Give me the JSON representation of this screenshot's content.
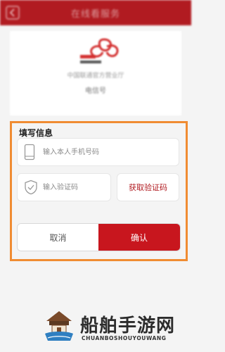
{
  "header": {
    "title": "在线看服务"
  },
  "top_card": {
    "line1": "中国联通官方营业厅",
    "line2": "电信号"
  },
  "form": {
    "section_title": "填写信息",
    "phone": {
      "placeholder": "输入本人手机号码",
      "value": ""
    },
    "code": {
      "placeholder": "输入验证码",
      "value": ""
    },
    "get_code_label": "获取验证码",
    "cancel_label": "取消",
    "confirm_label": "确认"
  },
  "colors": {
    "brand_red": "#c8161e",
    "highlight_frame": "#f08c32"
  },
  "icons": {
    "phone_icon": "phone-icon",
    "shield_icon": "shield-check-icon",
    "back_icon": "chevron-left-icon"
  },
  "watermark": {
    "title": "船舶手游网",
    "subtitle": "CHUANBOSHOUYOUWANG"
  }
}
